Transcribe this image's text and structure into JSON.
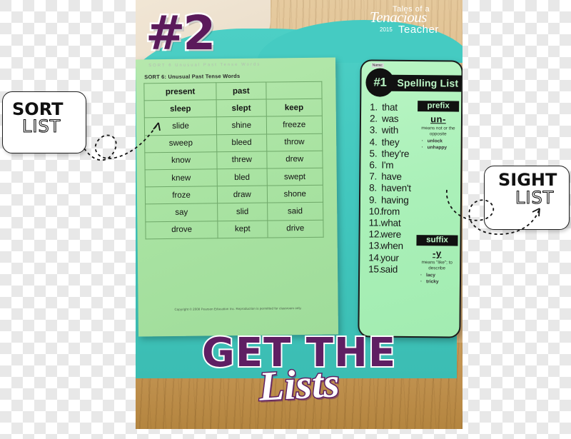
{
  "badge": {
    "number": "#2"
  },
  "logo": {
    "line1": "Tales of a",
    "big": "Tenacious",
    "line3": "Teacher",
    "year": "2015"
  },
  "callouts": {
    "sort": {
      "bold": "SORT",
      "thin": "LIST"
    },
    "sight": {
      "bold": "SIGHT",
      "thin": "LIST"
    }
  },
  "sort_sheet": {
    "ghost_header": "SORT 6  Unusual Past Tense Words",
    "title": "SORT 6: Unusual Past Tense Words",
    "copyright": "Copyright © 2008 Pearson Education Inc.  Reproduction is permitted for classroom only.",
    "columns": [
      "present",
      "past",
      ""
    ],
    "rows": [
      [
        "sleep",
        "slept",
        "keep"
      ],
      [
        "slide",
        "shine",
        "freeze"
      ],
      [
        "sweep",
        "bleed",
        "throw"
      ],
      [
        "know",
        "threw",
        "drew"
      ],
      [
        "knew",
        "bled",
        "swept"
      ],
      [
        "froze",
        "draw",
        "shone"
      ],
      [
        "say",
        "slid",
        "said"
      ],
      [
        "drove",
        "kept",
        "drive"
      ]
    ]
  },
  "spelling_card": {
    "name_label": "Name:",
    "badge": "#1",
    "title": "Spelling List",
    "words": [
      "that",
      "was",
      "with",
      "they",
      "they're",
      "I'm",
      "have",
      "haven't",
      "having",
      "from",
      "what",
      "were",
      "when",
      "your",
      "said"
    ],
    "prefix": {
      "label": "prefix",
      "morpheme": "un-",
      "meaning": "means not or the opposite",
      "examples": [
        "unlock",
        "unhappy"
      ]
    },
    "suffix": {
      "label": "suffix",
      "morpheme": "-y",
      "meaning": "means \"like\"; to describe",
      "examples": [
        "lacy",
        "tricky"
      ]
    }
  },
  "headline": {
    "top": "GET THE",
    "script": "Lists"
  },
  "colors": {
    "purple": "#5f1f63",
    "teal": "#45cbc2",
    "green_sheet": "#a9e3a2",
    "green_card": "#aaf0b8",
    "wood": "#c0914f"
  }
}
